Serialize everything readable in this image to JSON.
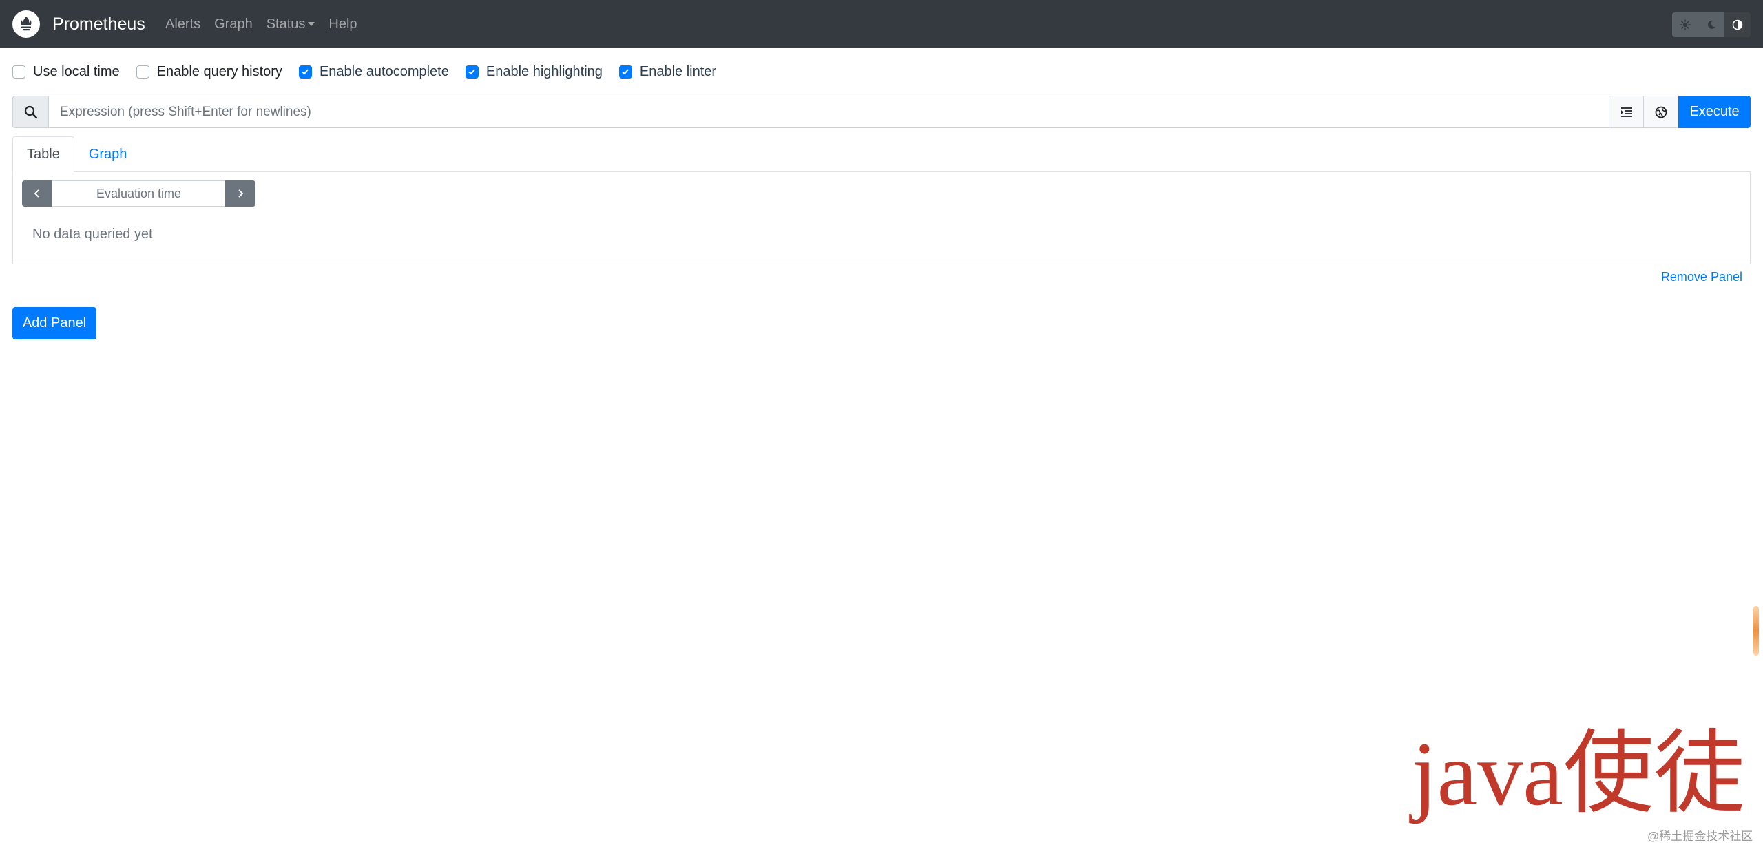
{
  "navbar": {
    "brand": "Prometheus",
    "links": [
      {
        "label": "Alerts"
      },
      {
        "label": "Graph"
      },
      {
        "label": "Status"
      },
      {
        "label": "Help"
      }
    ],
    "theme_icons": [
      "sun-icon",
      "moon-icon",
      "half-circle-icon"
    ]
  },
  "options": [
    {
      "label": "Use local time",
      "checked": false
    },
    {
      "label": "Enable query history",
      "checked": false
    },
    {
      "label": "Enable autocomplete",
      "checked": true
    },
    {
      "label": "Enable highlighting",
      "checked": true
    },
    {
      "label": "Enable linter",
      "checked": true
    }
  ],
  "expression": {
    "value": "",
    "placeholder": "Expression (press Shift+Enter for newlines)",
    "execute_label": "Execute"
  },
  "panel": {
    "tabs": [
      {
        "label": "Table",
        "active": true
      },
      {
        "label": "Graph",
        "active": false
      }
    ],
    "eval_placeholder": "Evaluation time",
    "empty_text": "No data queried yet",
    "remove_label": "Remove Panel"
  },
  "add_panel_label": "Add Panel",
  "watermark": "java使徒",
  "footer_mark": "@稀土掘金技术社区",
  "colors": {
    "navbar": "#343a40",
    "primary": "#007bff",
    "secondary": "#6c757d",
    "watermark": "#c0392b"
  }
}
